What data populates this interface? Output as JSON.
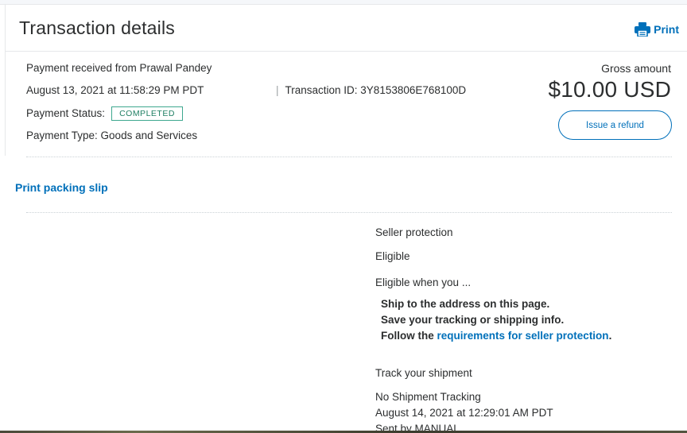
{
  "header": {
    "title": "Transaction details",
    "print_label": "Print"
  },
  "summary": {
    "received_from": "Payment received from Prawal Pandey",
    "datetime": "August 13, 2021 at 11:58:29 PM PDT",
    "status_label": "Payment Status:",
    "status_value": "COMPLETED",
    "payment_type": "Payment Type: Goods and Services",
    "transaction_id": "Transaction ID: 3Y8153806E768100D",
    "gross_label": "Gross amount",
    "gross_amount": "$10.00 USD",
    "refund_label": "Issue a refund"
  },
  "packing_slip_label": "Print packing slip",
  "seller_protection": {
    "title": "Seller protection",
    "value": "Eligible",
    "eligible_when": "Eligible when you ...",
    "req1": "Ship to the address on this page.",
    "req2": "Save your tracking or shipping info.",
    "req3_prefix": "Follow the ",
    "req3_link": "requirements for seller protection",
    "req3_suffix": "."
  },
  "shipment": {
    "title": "Track your shipment",
    "tracking": "No Shipment Tracking",
    "date": "August 14, 2021 at 12:29:01 AM PDT",
    "sent_by": "Sent by MANUAL"
  },
  "colors": {
    "link": "#0070ba",
    "status_border": "#3ea88f",
    "text": "#2c2e2f"
  },
  "icons": {
    "print": "printer-icon"
  }
}
